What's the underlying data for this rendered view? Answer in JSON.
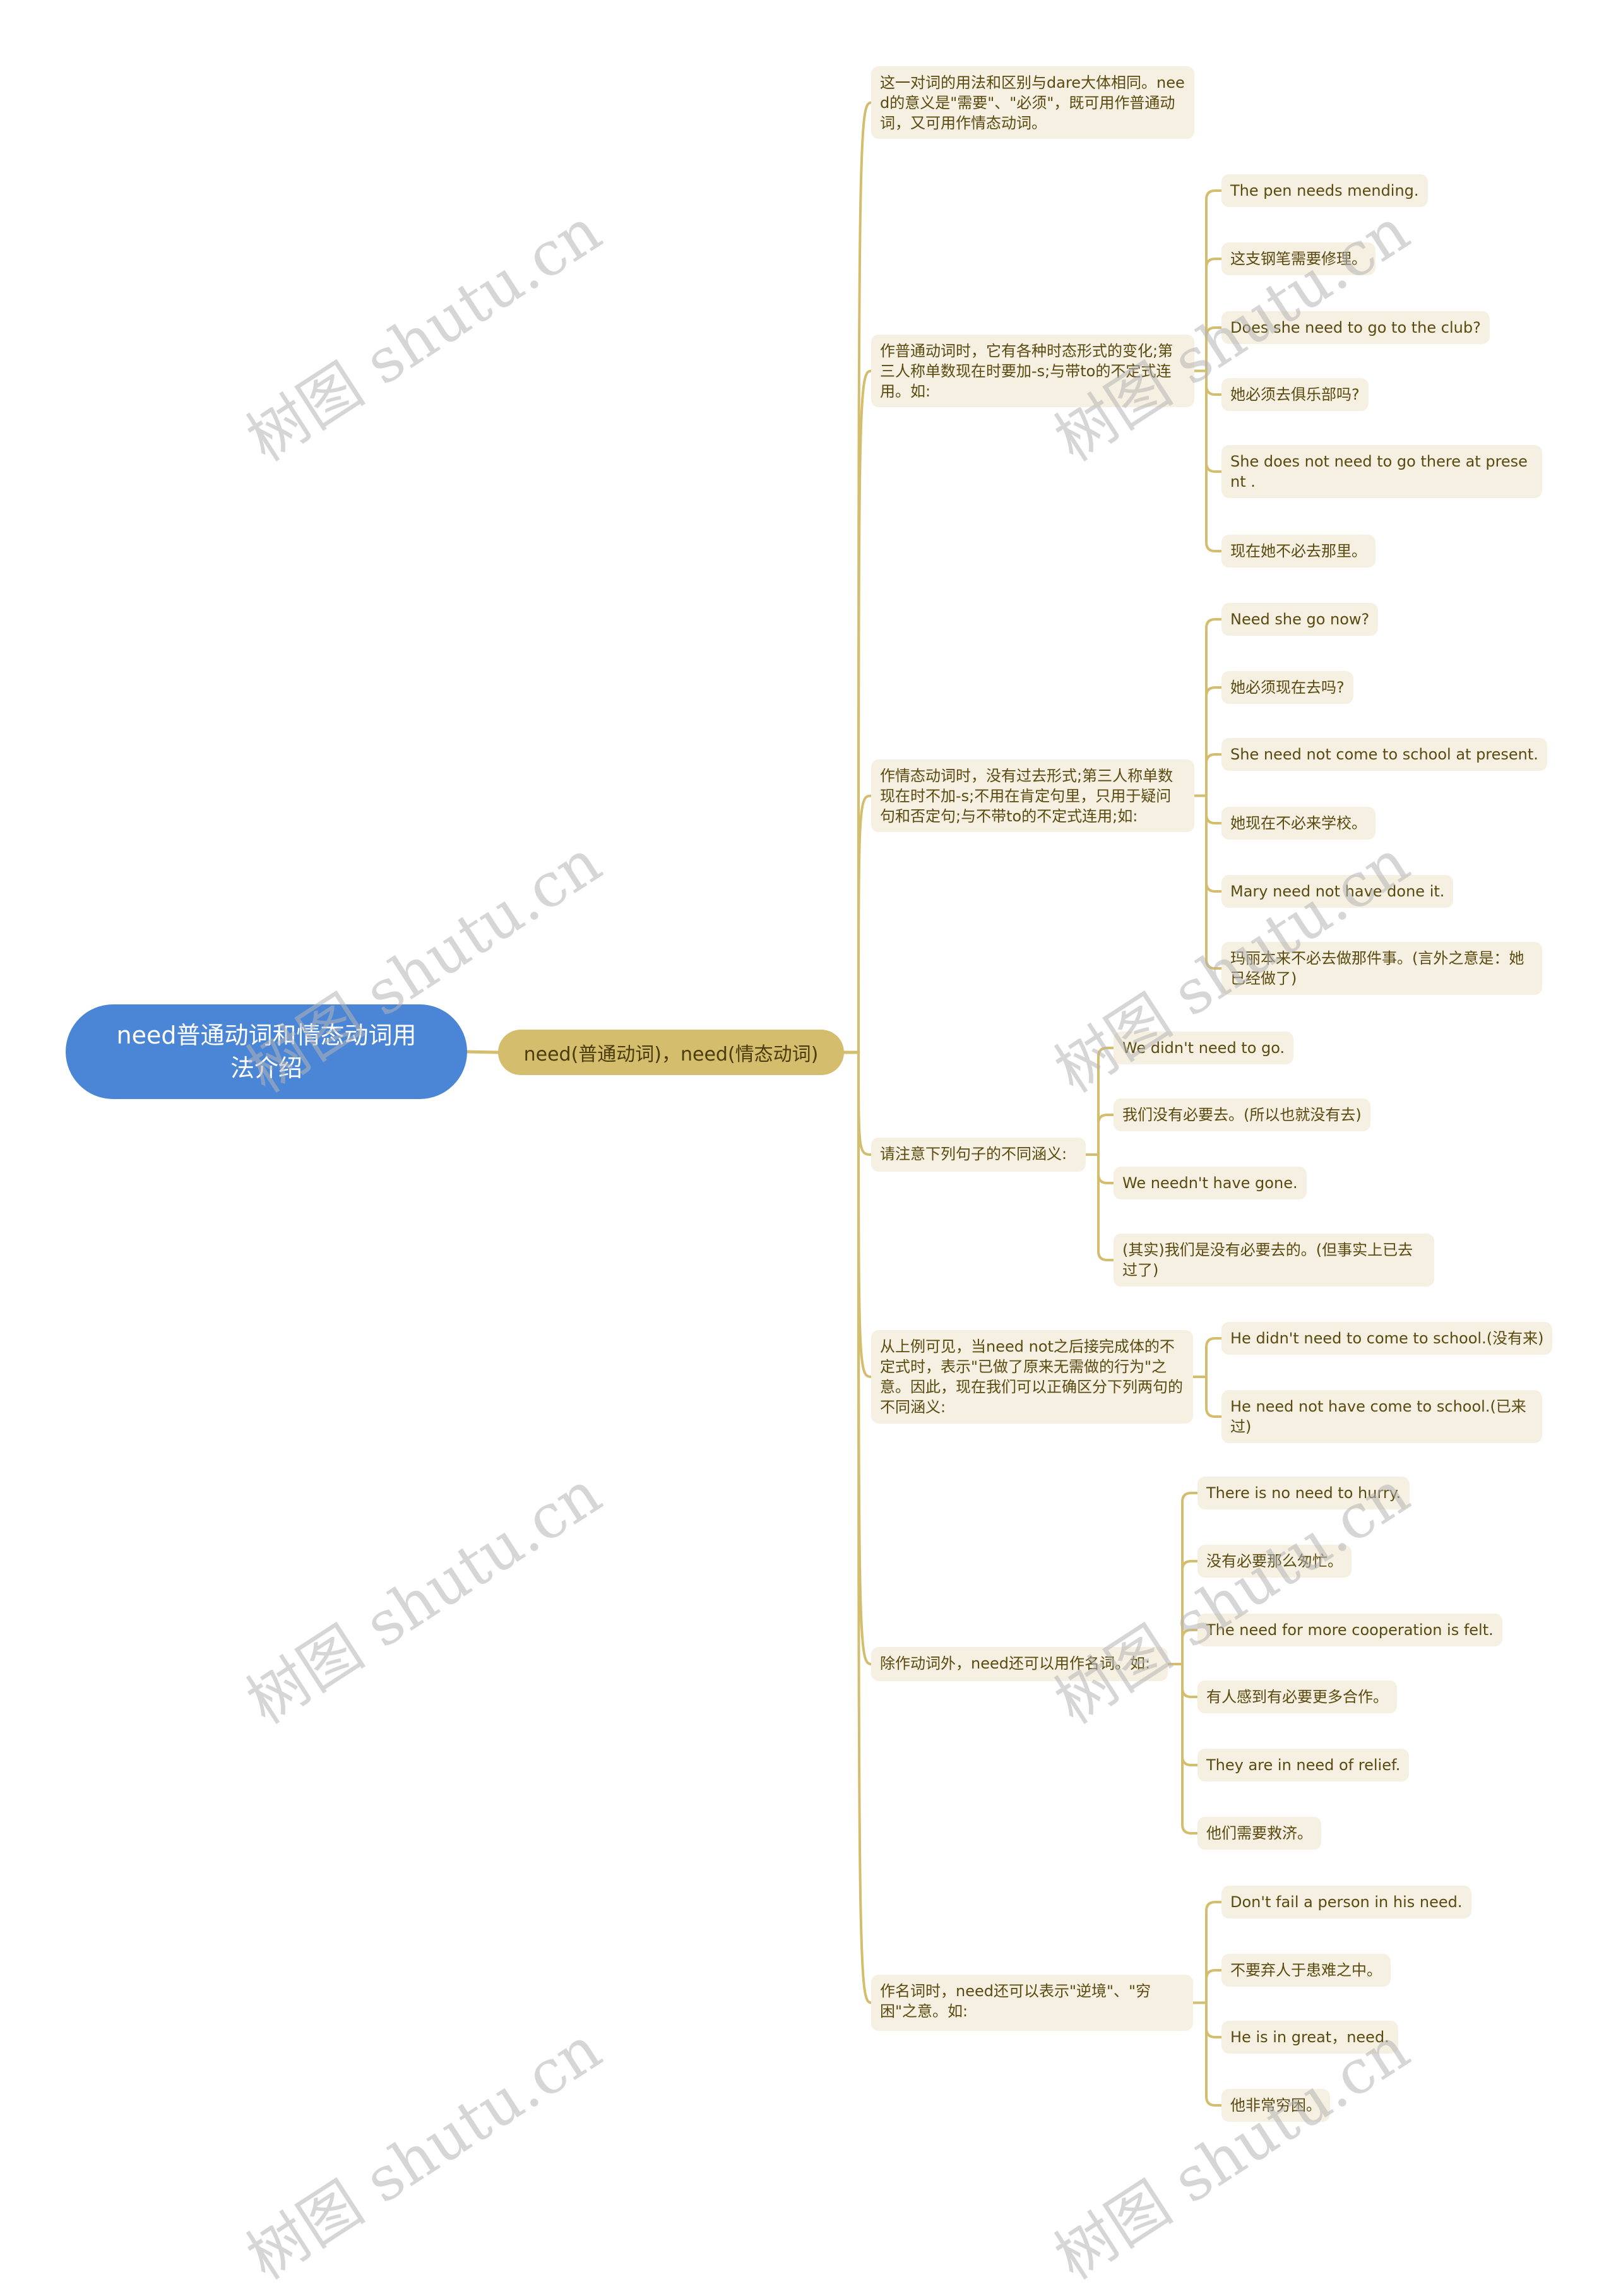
{
  "root": {
    "label": "need普通动词和情态动词用法介绍"
  },
  "hub": {
    "label": "need(普通动词)，need(情态动词)"
  },
  "colors": {
    "root": "#4b86d6",
    "hub": "#d4bd6c",
    "node_bg": "#f5f0e1",
    "line": "#d4bd6c",
    "text": "#5a4a10"
  },
  "branches": [
    {
      "label": "这一对词的用法和区别与dare大体相同。need的意义是\"需要\"、\"必须\"，既可用作普通动词，又可用作情态动词。",
      "children": []
    },
    {
      "label": "作普通动词时，它有各种时态形式的变化;第三人称单数现在时要加-s;与带to的不定式连用。如:",
      "children": [
        "The pen needs mending.",
        "这支钢笔需要修理。",
        "Does she need to go to the club?",
        "她必须去俱乐部吗?",
        "She does not need to go there at present .",
        "现在她不必去那里。"
      ]
    },
    {
      "label": "作情态动词时，没有过去形式;第三人称单数现在时不加-s;不用在肯定句里，只用于疑问句和否定句;与不带to的不定式连用;如:",
      "children": [
        "Need she go now?",
        "她必须现在去吗?",
        "She need not come to school at present.",
        "她现在不必来学校。",
        "Mary need not have done it.",
        "玛丽本来不必去做那件事。(言外之意是：她已经做了)"
      ]
    },
    {
      "label": "请注意下列句子的不同涵义:",
      "children": [
        "We didn't need to go.",
        "我们没有必要去。(所以也就没有去)",
        "We needn't have gone.",
        "(其实)我们是没有必要去的。(但事实上已去过了)"
      ]
    },
    {
      "label": "从上例可见，当need not之后接完成体的不定式时，表示\"已做了原来无需做的行为\"之意。因此，现在我们可以正确区分下列两句的不同涵义:",
      "children": [
        "He didn't need to come to school.(没有来)",
        "He need not have come to school.(已来过)"
      ]
    },
    {
      "label": "除作动词外，need还可以用作名词。如:",
      "children": [
        "There is no need to hurry.",
        "没有必要那么匆忙。",
        "The need for more cooperation is felt.",
        "有人感到有必要更多合作。",
        "They are in need of relief.",
        "他们需要救济。"
      ]
    },
    {
      "label": "作名词时，need还可以表示\"逆境\"、\"穷困\"之意。如:",
      "children": [
        "Don't fail a person in his need.",
        "不要弃人于患难之中。",
        "He is in great，need.",
        "他非常穷困。"
      ]
    }
  ],
  "watermark": {
    "text": "树图 shutu.cn"
  }
}
